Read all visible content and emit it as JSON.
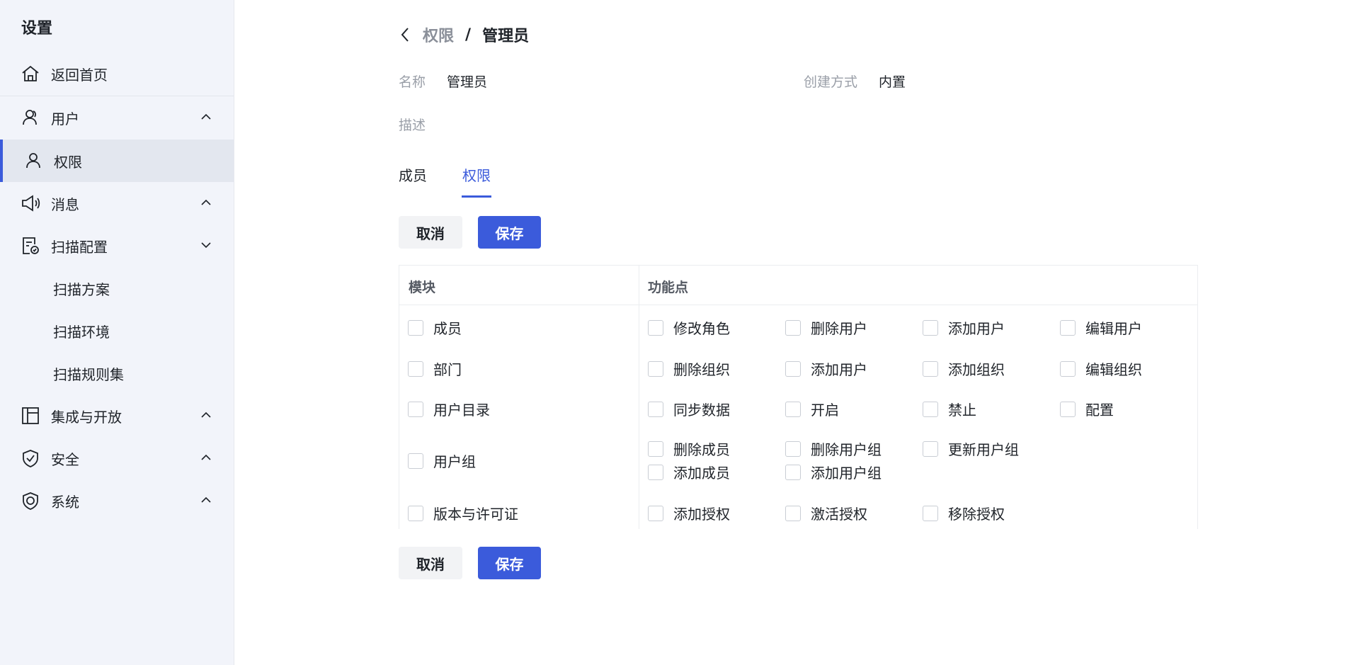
{
  "sidebar": {
    "title": "设置",
    "items": [
      {
        "label": "返回首页",
        "icon": "home-icon"
      },
      {
        "label": "用户",
        "icon": "users-icon"
      },
      {
        "label": "权限",
        "icon": "user-icon"
      },
      {
        "label": "消息",
        "icon": "megaphone-icon"
      },
      {
        "label": "扫描配置",
        "icon": "scan-config-icon"
      },
      {
        "label": "扫描方案"
      },
      {
        "label": "扫描环境"
      },
      {
        "label": "扫描规则集"
      },
      {
        "label": "集成与开放",
        "icon": "layout-icon"
      },
      {
        "label": "安全",
        "icon": "shield-check-icon"
      },
      {
        "label": "系统",
        "icon": "certificate-icon"
      }
    ]
  },
  "breadcrumb": {
    "parent": "权限",
    "separator": "/",
    "current": "管理员"
  },
  "info": {
    "name_label": "名称",
    "name_value": "管理员",
    "created_label": "创建方式",
    "created_value": "内置",
    "desc_label": "描述"
  },
  "tabs": [
    {
      "label": "成员"
    },
    {
      "label": "权限"
    }
  ],
  "actions": {
    "cancel": "取消",
    "save": "保存"
  },
  "table": {
    "headers": {
      "module": "模块",
      "features": "功能点"
    },
    "rows": [
      {
        "module": "成员",
        "features": [
          "修改角色",
          "删除用户",
          "添加用户",
          "编辑用户"
        ]
      },
      {
        "module": "部门",
        "features": [
          "删除组织",
          "添加用户",
          "添加组织",
          "编辑组织"
        ]
      },
      {
        "module": "用户目录",
        "features": [
          "同步数据",
          "开启",
          "禁止",
          "配置"
        ]
      },
      {
        "module": "用户组",
        "features": [
          "删除成员",
          "删除用户组",
          "更新用户组",
          "添加成员",
          "添加用户组"
        ]
      },
      {
        "module": "版本与许可证",
        "features": [
          "添加授权",
          "激活授权",
          "移除授权"
        ]
      }
    ]
  },
  "colors": {
    "accent": "#3b5bdb",
    "sidebar_bg": "#f2f4fa",
    "active_bg": "#e3e7ef"
  }
}
